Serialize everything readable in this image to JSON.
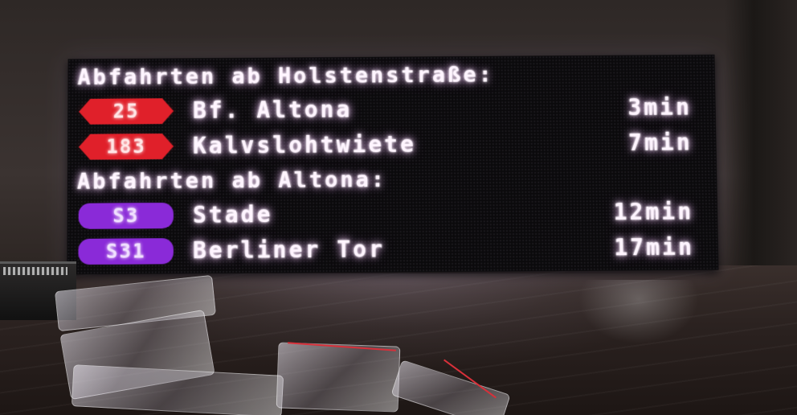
{
  "display": {
    "sections": [
      {
        "header": "Abfahrten ab Holstenstraße:",
        "departures": [
          {
            "line": "25",
            "kind": "bus",
            "destination": "Bf. Altona",
            "time": "3min"
          },
          {
            "line": "183",
            "kind": "bus",
            "destination": "Kalvslohtwiete",
            "time": "7min"
          }
        ]
      },
      {
        "header": "Abfahrten ab Altona:",
        "departures": [
          {
            "line": "S3",
            "kind": "sbahn",
            "destination": "Stade",
            "time": "12min"
          },
          {
            "line": "S31",
            "kind": "sbahn",
            "destination": "Berliner Tor",
            "time": "17min"
          }
        ]
      }
    ]
  },
  "colors": {
    "bus_badge": "#e0202a",
    "sbahn_badge": "#8a2ad8",
    "led_text": "#fff5ff",
    "panel_background": "#0b0a0c"
  }
}
